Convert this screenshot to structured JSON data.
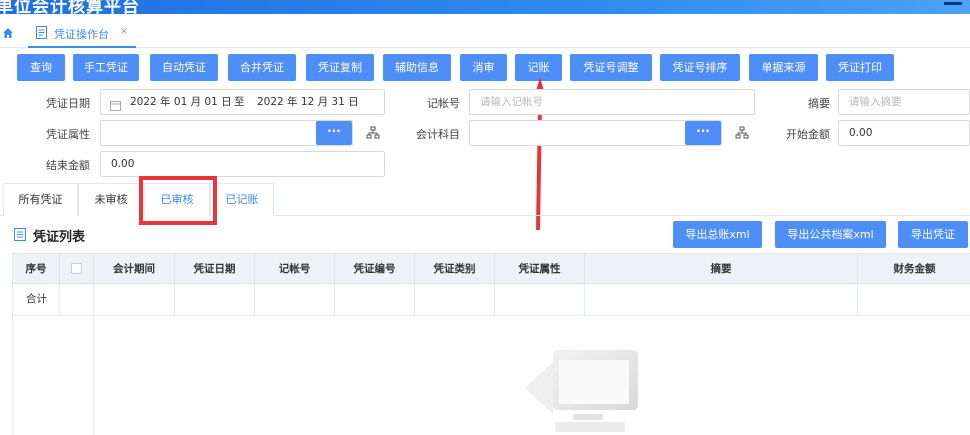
{
  "app": {
    "title": "单位会计核算平台"
  },
  "tabs": [
    {
      "label": "凭证操作台",
      "close": "×"
    }
  ],
  "toolbar": {
    "buttons": [
      "查询",
      "手工凭证",
      "自动凭证",
      "合并凭证",
      "凭证复制",
      "辅助信息",
      "消审",
      "记账",
      "凭证号调整",
      "凭证号排序",
      "单据来源",
      "凭证打印"
    ]
  },
  "filters": {
    "voucher_date_label": "凭证日期",
    "date_start": "2022 年 01 月 01 日",
    "date_sep": "至",
    "date_end": "2022 年 12 月 31 日",
    "account_no_label": "记帐号",
    "account_no_placeholder": "请输入记帐号",
    "summary_label": "摘要",
    "summary_placeholder": "请输入摘要",
    "voucher_attr_label": "凭证属性",
    "voucher_attr_value": "",
    "subject_label": "会计科目",
    "subject_value": "",
    "start_amount_label": "开始金额",
    "start_amount_value": "0.00",
    "end_amount_label": "结束金额",
    "end_amount_value": "0.00",
    "dots": "···"
  },
  "filter_tabs": [
    {
      "label": "所有凭证",
      "selected": false
    },
    {
      "label": "未审核",
      "selected": false
    },
    {
      "label": "已审核",
      "selected": true
    },
    {
      "label": "已记账",
      "selected": false
    }
  ],
  "section": {
    "title": "凭证列表"
  },
  "export_buttons": [
    "导出总账xml",
    "导出公共档案xml",
    "导出凭证"
  ],
  "table": {
    "columns": [
      "序号",
      "",
      "会计期间",
      "凭证日期",
      "记帐号",
      "凭证编号",
      "凭证类别",
      "凭证属性",
      "摘要",
      "财务金额"
    ],
    "summary_row_label": "合计"
  },
  "colors": {
    "accent": "#4e8ef7",
    "highlight": "#e8353b"
  }
}
